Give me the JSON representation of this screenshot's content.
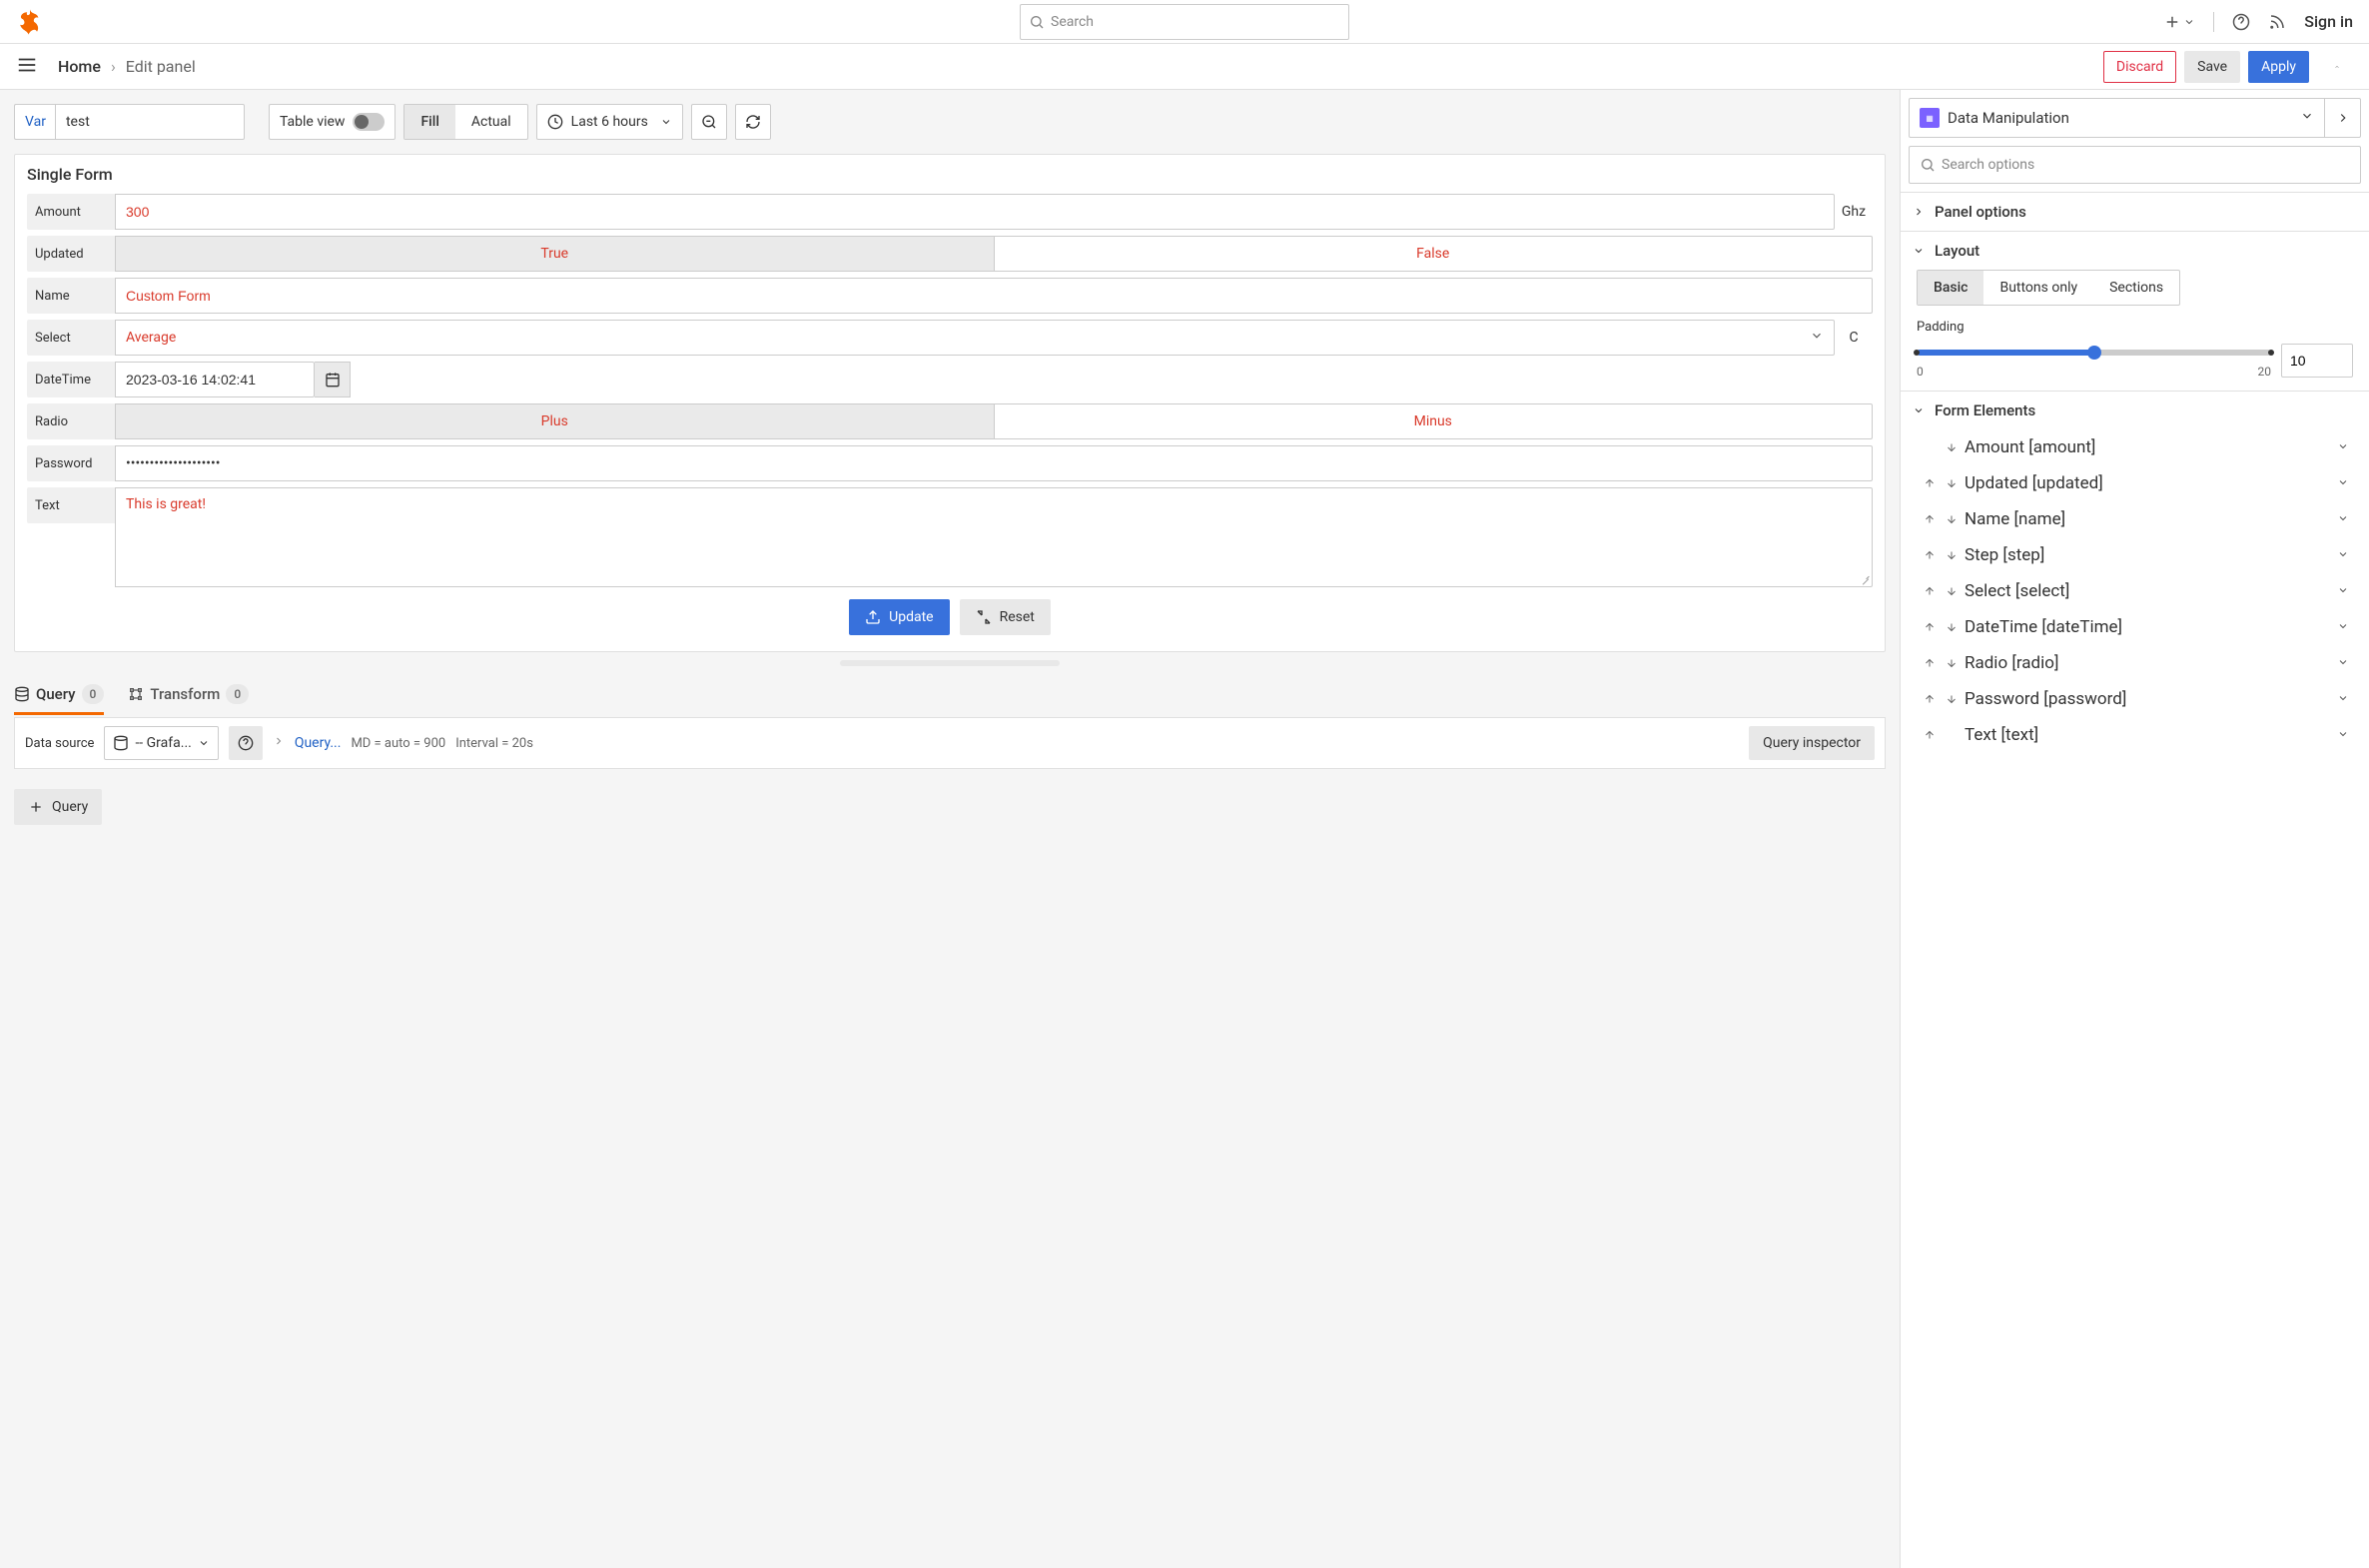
{
  "topbar": {
    "search_placeholder": "Search",
    "signin": "Sign in"
  },
  "breadcrumb": {
    "home": "Home",
    "sep": "›",
    "current": "Edit panel",
    "discard": "Discard",
    "save": "Save",
    "apply": "Apply"
  },
  "toolbar": {
    "var_label": "Var",
    "var_value": "test",
    "table_view": "Table view",
    "fill": "Fill",
    "actual": "Actual",
    "time_range": "Last 6 hours"
  },
  "panel": {
    "title": "Single Form",
    "amount_label": "Amount",
    "amount_value": "300",
    "amount_suffix": "Ghz",
    "updated_label": "Updated",
    "updated_true": "True",
    "updated_false": "False",
    "name_label": "Name",
    "name_value": "Custom Form",
    "select_label": "Select",
    "select_value": "Average",
    "select_suffix": "C",
    "datetime_label": "DateTime",
    "datetime_value": "2023-03-16 14:02:41",
    "radio_label": "Radio",
    "radio_plus": "Plus",
    "radio_minus": "Minus",
    "password_label": "Password",
    "password_value": "••••••••••••••••••••",
    "text_label": "Text",
    "text_value": "This is great!",
    "update_btn": "Update",
    "reset_btn": "Reset"
  },
  "tabs": {
    "query": "Query",
    "query_count": "0",
    "transform": "Transform",
    "transform_count": "0"
  },
  "query_panel": {
    "ds_label": "Data source",
    "ds_value": "-- Grafa...",
    "query_opts": "Query...",
    "md": "MD = auto = 900",
    "interval": "Interval = 20s",
    "inspector": "Query inspector",
    "add_query": "Query"
  },
  "side": {
    "plugin": "Data Manipulation",
    "search_placeholder": "Search options",
    "panel_options": "Panel options",
    "layout": "Layout",
    "layout_basic": "Basic",
    "layout_buttons": "Buttons only",
    "layout_sections": "Sections",
    "padding_label": "Padding",
    "padding_min": "0",
    "padding_max": "20",
    "padding_value": "10",
    "form_elements": "Form Elements",
    "elements": [
      {
        "up": false,
        "down": true,
        "label": "Amount [amount]"
      },
      {
        "up": true,
        "down": true,
        "label": "Updated [updated]"
      },
      {
        "up": true,
        "down": true,
        "label": "Name [name]"
      },
      {
        "up": true,
        "down": true,
        "label": "Step [step]"
      },
      {
        "up": true,
        "down": true,
        "label": "Select [select]"
      },
      {
        "up": true,
        "down": true,
        "label": "DateTime [dateTime]"
      },
      {
        "up": true,
        "down": true,
        "label": "Radio [radio]"
      },
      {
        "up": true,
        "down": true,
        "label": "Password [password]"
      },
      {
        "up": true,
        "down": false,
        "label": "Text [text]"
      }
    ]
  }
}
